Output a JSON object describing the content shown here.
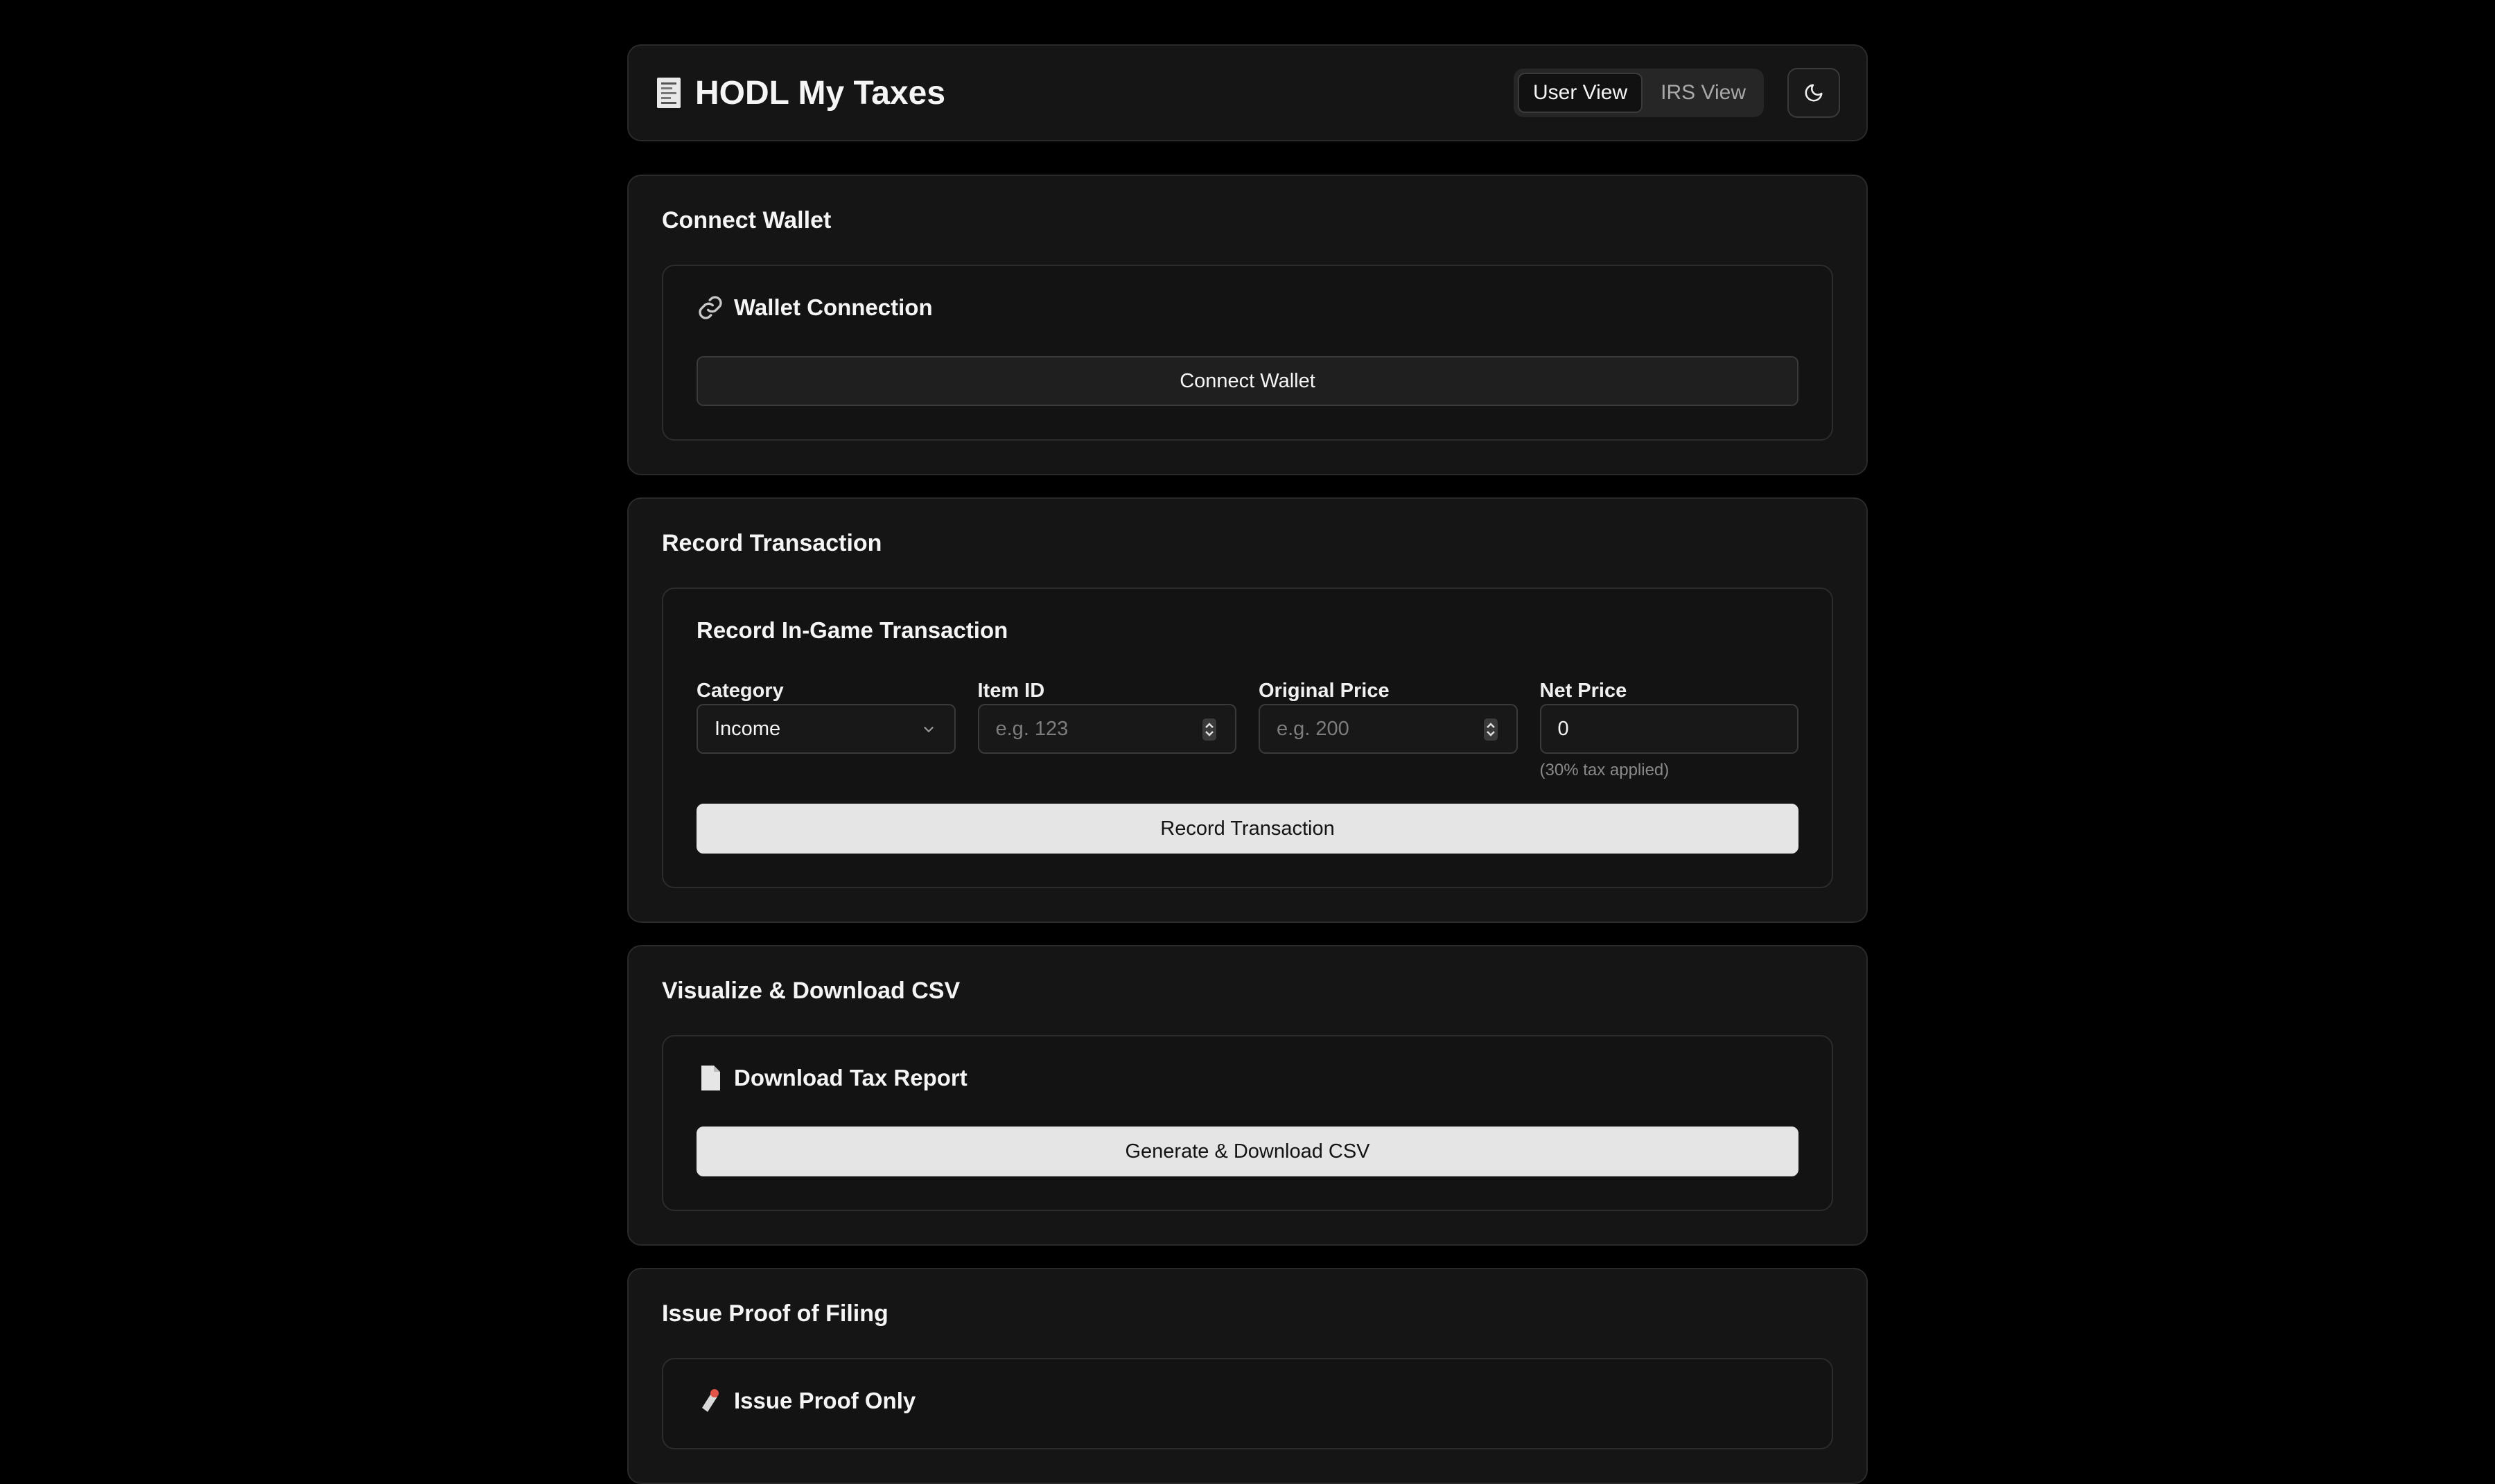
{
  "header": {
    "title": "HODL My Taxes",
    "view_toggle": {
      "user_view": "User View",
      "irs_view": "IRS View",
      "active": "User View"
    },
    "theme_icon": "moon-icon"
  },
  "connect_wallet": {
    "section_title": "Connect Wallet",
    "card_title": "Wallet Connection",
    "card_icon": "link-icon",
    "button": "Connect Wallet"
  },
  "record_transaction": {
    "section_title": "Record Transaction",
    "card_title": "Record In-Game Transaction",
    "category": {
      "label": "Category",
      "value": "Income"
    },
    "item_id": {
      "label": "Item ID",
      "placeholder": "e.g. 123"
    },
    "original_price": {
      "label": "Original Price",
      "placeholder": "e.g. 200"
    },
    "net_price": {
      "label": "Net Price",
      "value": "0",
      "hint": "(30% tax applied)"
    },
    "button": "Record Transaction"
  },
  "visualize": {
    "section_title": "Visualize & Download CSV",
    "card_title": "Download Tax Report",
    "card_icon": "document-icon",
    "button": "Generate & Download CSV"
  },
  "proof": {
    "section_title": "Issue Proof of Filing",
    "card_title": "Issue Proof Only",
    "card_icon": "stamp-icon"
  }
}
